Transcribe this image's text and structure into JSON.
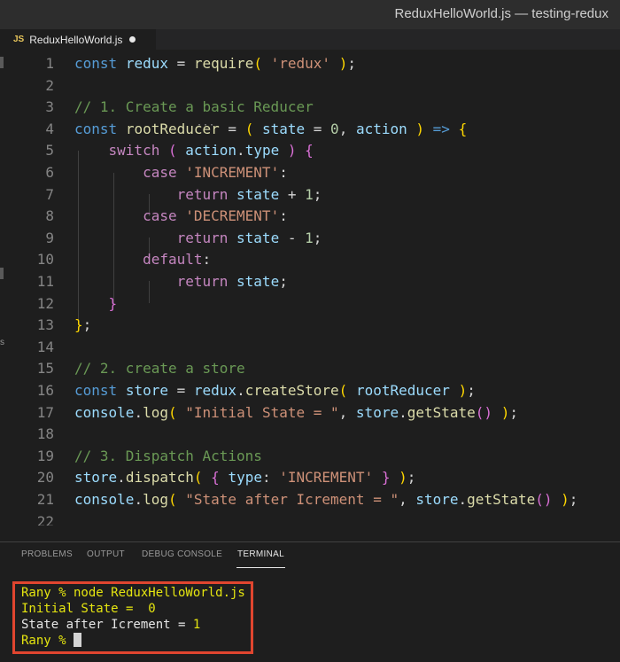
{
  "window": {
    "title": "ReduxHelloWorld.js — testing-redux"
  },
  "tab": {
    "icon": "JS",
    "filename": "ReduxHelloWorld.js"
  },
  "sidebar_fragment": {
    "letter": "s"
  },
  "editor": {
    "line_numbers": [
      "1",
      "2",
      "3",
      "4",
      "5",
      "6",
      "7",
      "8",
      "9",
      "10",
      "11",
      "12",
      "13",
      "14",
      "15",
      "16",
      "17",
      "18",
      "19",
      "20",
      "21",
      "22"
    ]
  },
  "panel": {
    "tabs": [
      "PROBLEMS",
      "OUTPUT",
      "DEBUG CONSOLE",
      "TERMINAL"
    ],
    "active_tab": "TERMINAL"
  },
  "terminal": {
    "lines": [
      "Rany % node ReduxHelloWorld.js",
      "Initial State =  0",
      "State after Icrement = ",
      "1",
      "Rany % "
    ]
  },
  "colors": {
    "keyword": "#569cd6",
    "control": "#c586c0",
    "variable": "#9cdcfe",
    "function": "#dcdcaa",
    "string": "#ce9178",
    "number": "#b5cea8",
    "comment": "#6a9955",
    "highlight_box": "#e0452f"
  }
}
